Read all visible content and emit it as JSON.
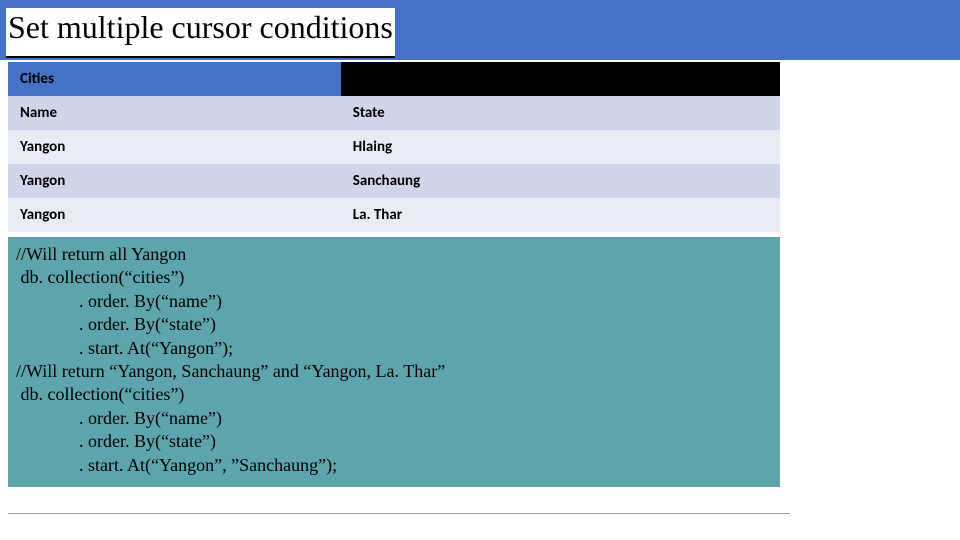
{
  "title": "Set multiple cursor conditions",
  "table": {
    "caption": "Cities",
    "headers": {
      "col1": "Name",
      "col2": "State"
    },
    "rows": [
      {
        "name": "Yangon",
        "state": "Hlaing"
      },
      {
        "name": "Yangon",
        "state": "Sanchaung"
      },
      {
        "name": "Yangon",
        "state": "La. Thar"
      }
    ]
  },
  "code": {
    "l1": "//Will return all Yangon",
    "l2": " db. collection(“cities”)",
    "l3": "              . order. By(“name”)",
    "l4": "              . order. By(“state”)",
    "l5": "              . start. At(“Yangon”);",
    "l6": "//Will return “Yangon, Sanchaung” and “Yangon, La. Thar”",
    "l7": " db. collection(“cities”)",
    "l8": "              . order. By(“name”)",
    "l9": "              . order. By(“state”)",
    "l10": "              . start. At(“Yangon”, ”Sanchaung”);"
  }
}
